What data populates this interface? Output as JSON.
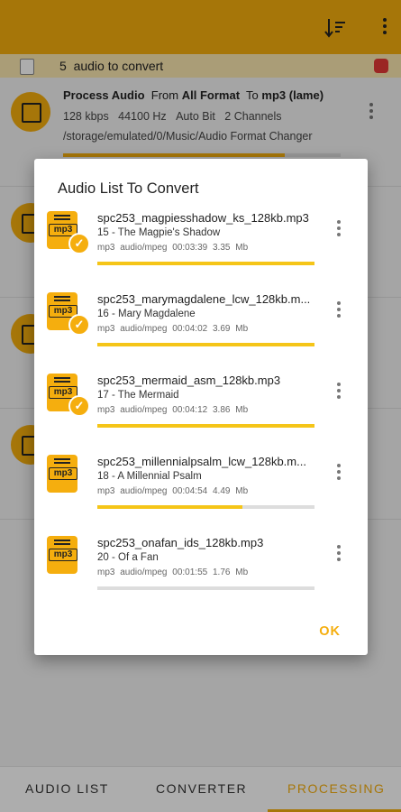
{
  "colors": {
    "accent": "#f5ae0e",
    "stop": "#e53935"
  },
  "app_bar": {
    "sort_icon": "sort-icon",
    "more_icon": "more-vert-icon"
  },
  "status": {
    "count": "5",
    "text": "audio to convert"
  },
  "card": {
    "title_prefix": "Process Audio",
    "from_label": "From",
    "from_value": "All Format",
    "to_label": "To",
    "to_value": "mp3 (lame)",
    "bitrate": "128 kbps",
    "sample_rate": "44100 Hz",
    "bit": "Auto Bit",
    "channels": "2 Channels",
    "path": "/storage/emulated/0/Music/Audio Format Changer"
  },
  "dialog": {
    "title": "Audio List To Convert",
    "ok_label": "OK",
    "items": [
      {
        "file": "spc253_magpiesshadow_ks_128kb.mp3",
        "track": "15 - The Magpie's Shadow",
        "ext": "mp3",
        "mime": "audio/mpeg",
        "duration": "00:03:39",
        "size": "3.35 Mb",
        "progress": 1.0,
        "done": true
      },
      {
        "file": "spc253_marymagdalene_lcw_128kb.m...",
        "track": "16 - Mary Magdalene",
        "ext": "mp3",
        "mime": "audio/mpeg",
        "duration": "00:04:02",
        "size": "3.69 Mb",
        "progress": 1.0,
        "done": true
      },
      {
        "file": "spc253_mermaid_asm_128kb.mp3",
        "track": "17 - The Mermaid",
        "ext": "mp3",
        "mime": "audio/mpeg",
        "duration": "00:04:12",
        "size": "3.86 Mb",
        "progress": 1.0,
        "done": true
      },
      {
        "file": "spc253_millennialpsalm_lcw_128kb.m...",
        "track": "18 - A Millennial Psalm",
        "ext": "mp3",
        "mime": "audio/mpeg",
        "duration": "00:04:54",
        "size": "4.49 Mb",
        "progress": 0.67,
        "done": false
      },
      {
        "file": "spc253_onafan_ids_128kb.mp3",
        "track": "20 - Of a Fan",
        "ext": "mp3",
        "mime": "audio/mpeg",
        "duration": "00:01:55",
        "size": "1.76 Mb",
        "progress": 0.0,
        "done": false
      }
    ]
  },
  "nav": {
    "tab1": "AUDIO LIST",
    "tab2": "CONVERTER",
    "tab3": "PROCESSING",
    "active": "PROCESSING"
  }
}
